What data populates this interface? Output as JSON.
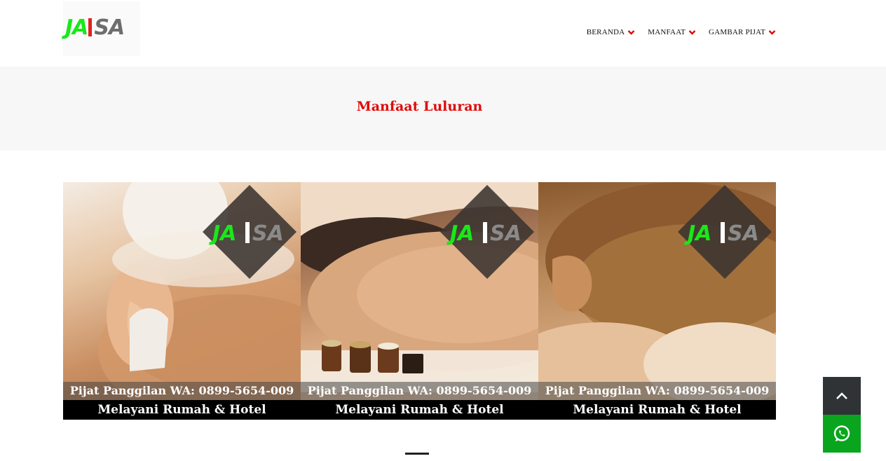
{
  "brand": {
    "logo_left": "JA",
    "logo_right": "SA",
    "colors": {
      "green": "#19e819",
      "red": "#e32020",
      "grey": "#6d6d6d"
    }
  },
  "nav": {
    "items": [
      {
        "label": "BERANDA",
        "icon": "chevron-down-icon"
      },
      {
        "label": "MANFAAT",
        "icon": "chevron-down-icon"
      },
      {
        "label": "GAMBAR PIJAT",
        "icon": "chevron-down-icon"
      }
    ]
  },
  "page": {
    "title": "Manfaat Luluran",
    "title_color": "#e00a0a"
  },
  "gallery": {
    "slides": [
      {
        "caption_top": "Pijat Panggilan WA: 0899-5654-009",
        "caption_bottom": "Melayani Rumah & Hotel"
      },
      {
        "caption_top": "Pijat Panggilan WA: 0899-5654-009",
        "caption_bottom": "Melayani Rumah & Hotel"
      },
      {
        "caption_top": "Pijat Panggilan WA: 0899-5654-009",
        "caption_bottom": "Melayani Rumah & Hotel"
      }
    ]
  },
  "floating": {
    "back_to_top_icon": "chevron-up-icon",
    "whatsapp_icon": "whatsapp-icon",
    "whatsapp_color": "#0aa51e"
  }
}
